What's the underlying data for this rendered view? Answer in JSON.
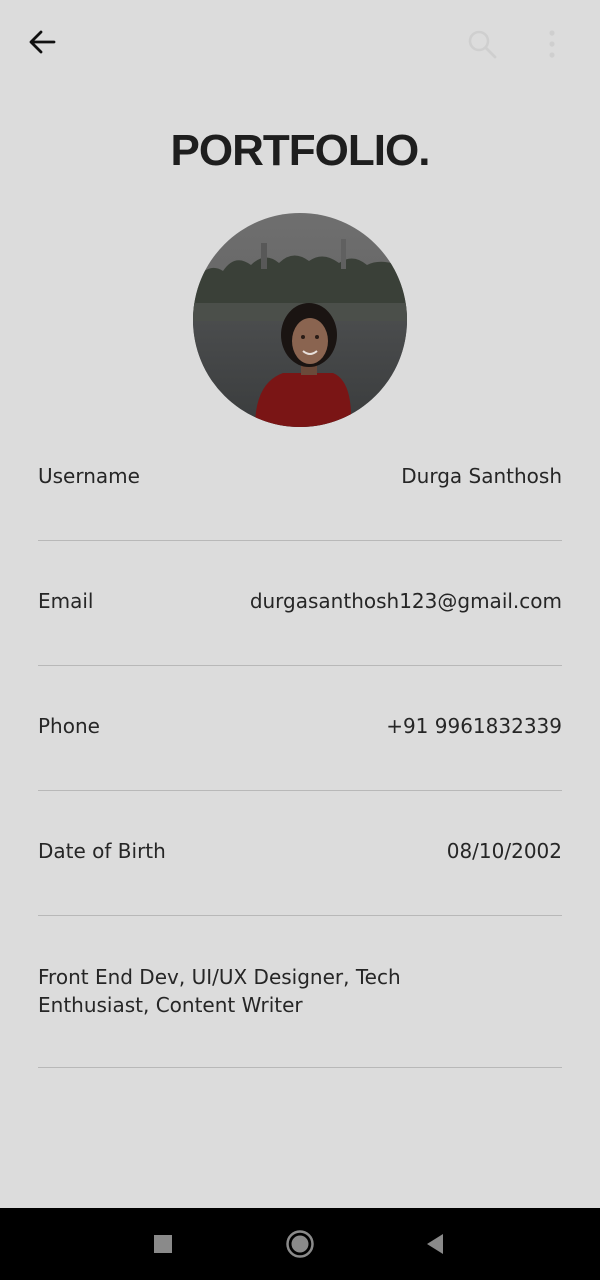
{
  "title": "PORTFOLIO.",
  "appbar": {
    "back_icon": "arrow-left-icon",
    "search_icon": "search-icon",
    "more_icon": "more-vertical-icon"
  },
  "profile": {
    "avatar_alt": "profile-photo"
  },
  "fields": [
    {
      "label": "Username",
      "value": "Durga Santhosh"
    },
    {
      "label": "Email",
      "value": "durgasanthosh123@gmail.com"
    },
    {
      "label": "Phone",
      "value": "+91 9961832339"
    },
    {
      "label": "Date of Birth",
      "value": "08/10/2002"
    }
  ],
  "bio": "Front End Dev, UI/UX Designer, Tech Enthusiast, Content Writer",
  "system_nav": {
    "recents_icon": "square-icon",
    "home_icon": "circle-home-icon",
    "back_icon": "triangle-back-icon"
  },
  "colors": {
    "background": "#dcdcdc",
    "divider": "#b8b8b8",
    "text": "#262626",
    "navbar": "#000000"
  }
}
